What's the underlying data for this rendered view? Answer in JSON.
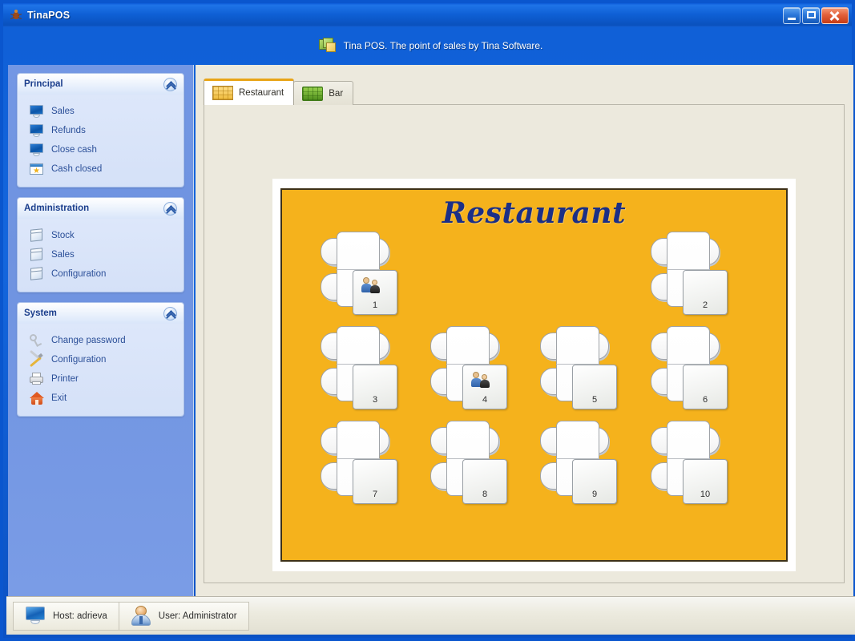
{
  "window": {
    "title": "TinaPOS",
    "icon": "bug-icon",
    "controls": {
      "minimize": "Minimize",
      "maximize": "Maximize",
      "close": "Close"
    }
  },
  "banner": {
    "icon": "cascading-windows-icon",
    "text": "Tina POS. The point of sales by Tina Software."
  },
  "sidebar": {
    "panels": [
      {
        "title": "Principal",
        "collapse_icon": "chevron-up-circle-icon",
        "items": [
          {
            "label": "Sales",
            "icon": "monitor-icon"
          },
          {
            "label": "Refunds",
            "icon": "monitor-icon"
          },
          {
            "label": "Close cash",
            "icon": "monitor-icon"
          },
          {
            "label": "Cash closed",
            "icon": "window-star-icon"
          }
        ]
      },
      {
        "title": "Administration",
        "collapse_icon": "chevron-up-circle-icon",
        "items": [
          {
            "label": "Stock",
            "icon": "box-icon"
          },
          {
            "label": "Sales",
            "icon": "box-icon"
          },
          {
            "label": "Configuration",
            "icon": "box-icon"
          }
        ]
      },
      {
        "title": "System",
        "collapse_icon": "chevron-up-circle-icon",
        "items": [
          {
            "label": "Change password",
            "icon": "key-icon"
          },
          {
            "label": "Configuration",
            "icon": "tools-icon"
          },
          {
            "label": "Printer",
            "icon": "printer-icon"
          },
          {
            "label": "Exit",
            "icon": "home-exit-icon"
          }
        ]
      }
    ]
  },
  "main": {
    "tabs": [
      {
        "label": "Restaurant",
        "icon": "restaurant-grid-icon",
        "active": true
      },
      {
        "label": "Bar",
        "icon": "bar-green-icon",
        "active": false
      }
    ],
    "floor": {
      "title": "Restaurant",
      "background_color": "#f5b21c",
      "tables": [
        {
          "number": "1",
          "occupied": true,
          "col": 0,
          "row": 0
        },
        {
          "number": "2",
          "occupied": false,
          "col": 3,
          "row": 0
        },
        {
          "number": "3",
          "occupied": false,
          "col": 0,
          "row": 1
        },
        {
          "number": "4",
          "occupied": true,
          "col": 1,
          "row": 1
        },
        {
          "number": "5",
          "occupied": false,
          "col": 2,
          "row": 1
        },
        {
          "number": "6",
          "occupied": false,
          "col": 3,
          "row": 1
        },
        {
          "number": "7",
          "occupied": false,
          "col": 0,
          "row": 2
        },
        {
          "number": "8",
          "occupied": false,
          "col": 1,
          "row": 2
        },
        {
          "number": "9",
          "occupied": false,
          "col": 2,
          "row": 2
        },
        {
          "number": "10",
          "occupied": false,
          "col": 3,
          "row": 2
        }
      ]
    }
  },
  "statusbar": {
    "cells": [
      {
        "label": "Host: adrieva",
        "icon": "monitor-icon"
      },
      {
        "label": "User: Administrator",
        "icon": "user-icon"
      }
    ]
  },
  "colors": {
    "title_bar": "#0e5fd4",
    "sidebar": "#7397e4",
    "panel_header_text": "#1b3e8c",
    "menu_text": "#2b4f98",
    "content_bg": "#ece9dd",
    "floor_bg": "#f5b21c",
    "floor_title": "#1b2f86",
    "tab_active_accent": "#e8a417",
    "close_button": "#c73c15"
  }
}
